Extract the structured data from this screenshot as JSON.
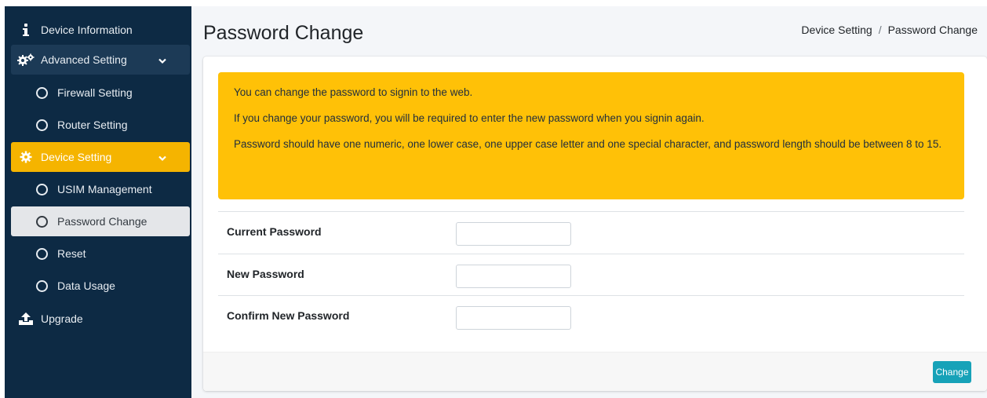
{
  "sidebar": {
    "items": [
      {
        "label": "Device Information",
        "icon": "info-icon"
      },
      {
        "label": "Advanced Setting",
        "icon": "gears-icon"
      },
      {
        "label": "Firewall Setting",
        "icon": "circle-icon"
      },
      {
        "label": "Router Setting",
        "icon": "circle-icon"
      },
      {
        "label": "Device Setting",
        "icon": "gear-icon"
      },
      {
        "label": "USIM Management",
        "icon": "circle-icon"
      },
      {
        "label": "Password Change",
        "icon": "circle-icon"
      },
      {
        "label": "Reset",
        "icon": "circle-icon"
      },
      {
        "label": "Data Usage",
        "icon": "circle-icon"
      },
      {
        "label": "Upgrade",
        "icon": "upload-icon"
      }
    ]
  },
  "header": {
    "title": "Password Change",
    "breadcrumb": [
      "Device Setting",
      "Password Change"
    ],
    "breadcrumb_sep": "/"
  },
  "alert": {
    "lines": [
      "You can change the password to signin to the web.",
      "If you change your password, you will be required to enter the new password when you signin again.",
      "Password should have one numeric, one lower case, one upper case letter and one special character, and password length should be between 8 to 15."
    ]
  },
  "form": {
    "current_password_label": "Current Password",
    "current_password_value": "",
    "new_password_label": "New Password",
    "new_password_value": "",
    "confirm_password_label": "Confirm New Password",
    "confirm_password_value": "",
    "change_button": "Change"
  },
  "colors": {
    "sidebar_bg": "#0d2a44",
    "active_group": "#f5b400",
    "alert_bg": "#ffc107",
    "button_bg": "#17a2b8"
  }
}
